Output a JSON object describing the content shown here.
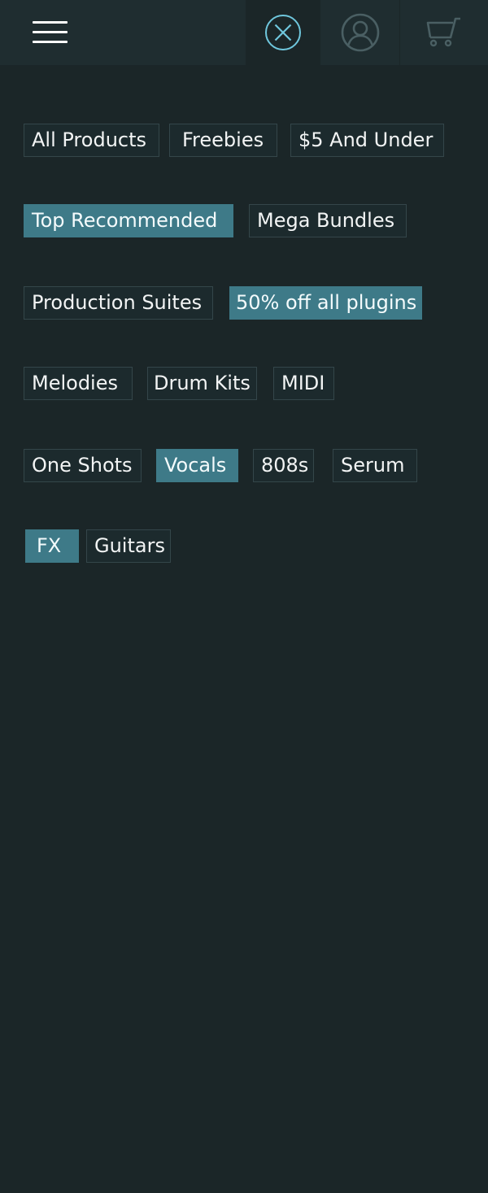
{
  "header": {
    "menu_icon": "hamburger-menu-icon",
    "close_icon": "close-circle-icon",
    "account_icon": "user-account-icon",
    "cart_icon": "shopping-cart-icon"
  },
  "colors": {
    "background": "#1b2628",
    "header": "#1f2d30",
    "accent": "#6fc7dd",
    "active_tag": "#3e7a88",
    "tag_border": "#34464a"
  },
  "tags": [
    {
      "label": "All Products",
      "active": false
    },
    {
      "label": "Freebies",
      "active": false
    },
    {
      "label": "$5 And Under",
      "active": false
    },
    {
      "label": "Top Recommended",
      "active": true
    },
    {
      "label": "Mega Bundles",
      "active": false
    },
    {
      "label": "Production Suites",
      "active": false
    },
    {
      "label": "50% off all plugins",
      "active": true
    },
    {
      "label": "Melodies",
      "active": false
    },
    {
      "label": "Drum Kits",
      "active": false
    },
    {
      "label": "MIDI",
      "active": false
    },
    {
      "label": "One Shots",
      "active": false
    },
    {
      "label": "Vocals",
      "active": true
    },
    {
      "label": "808s",
      "active": false
    },
    {
      "label": "Serum",
      "active": false
    },
    {
      "label": "FX",
      "active": true
    },
    {
      "label": "Guitars",
      "active": false
    }
  ]
}
